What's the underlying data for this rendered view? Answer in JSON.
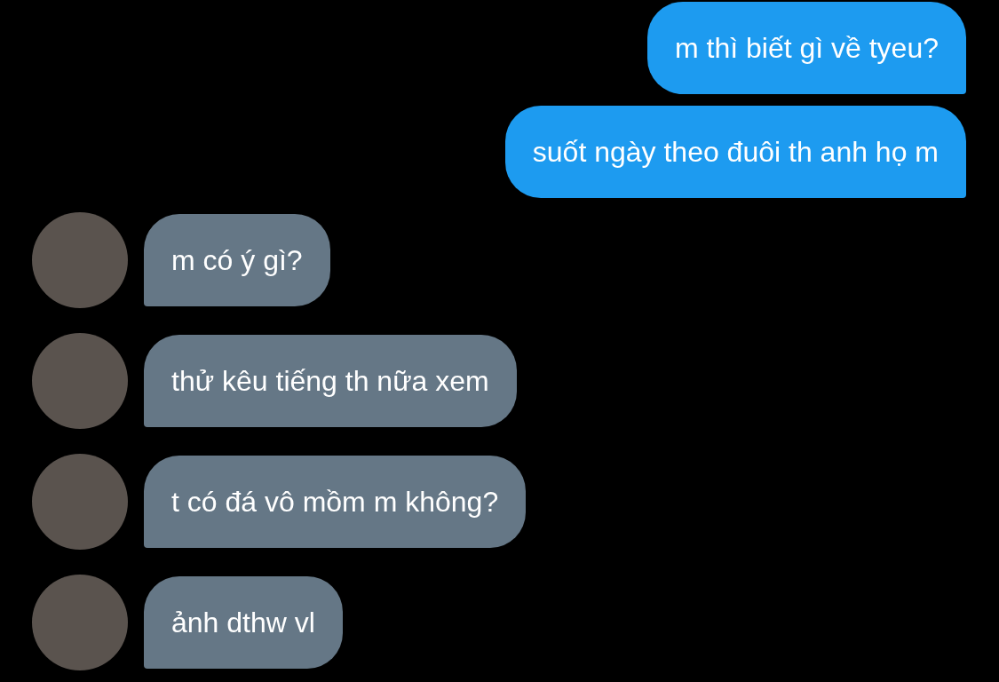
{
  "messages": [
    {
      "kind": "sent",
      "text": "m thì biết gì về tyeu?"
    },
    {
      "kind": "sent",
      "text": "suốt ngày theo đuôi th anh họ m"
    },
    {
      "kind": "received",
      "text": "m có ý gì?"
    },
    {
      "kind": "received",
      "text": "thử kêu tiếng th nữa xem"
    },
    {
      "kind": "received",
      "text": "t có đá vô mồm m không?"
    },
    {
      "kind": "received",
      "text": "ảnh dthw vl"
    }
  ]
}
